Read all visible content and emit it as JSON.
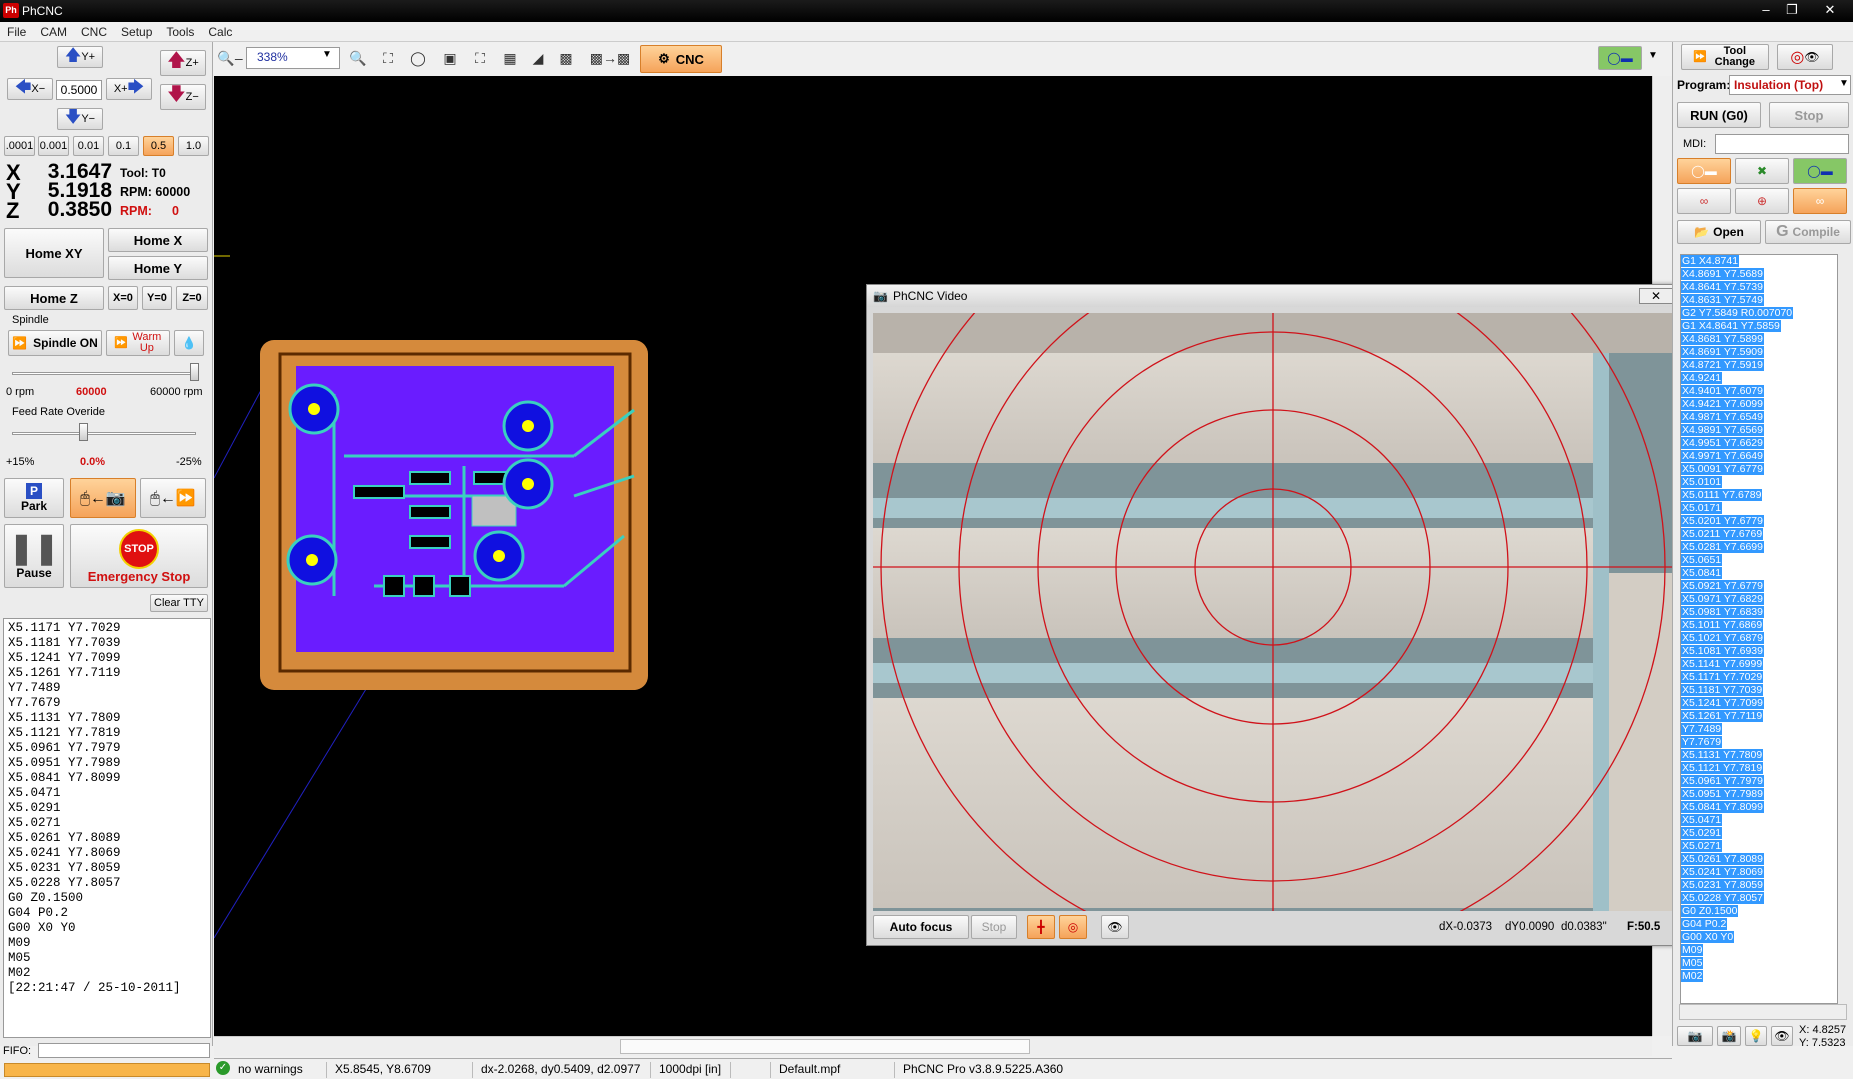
{
  "window": {
    "title": "PhCNC",
    "icon": "phcnc-app-icon"
  },
  "menu": [
    "File",
    "CAM",
    "CNC",
    "Setup",
    "Tools",
    "Calc"
  ],
  "jog": {
    "y_plus": "Y+",
    "y_minus": "Y−",
    "x_minus": "X−",
    "x_plus": "X+",
    "z_plus": "Z+",
    "z_minus": "Z−",
    "step_value": "0.5000",
    "steps": [
      ".0001",
      "0.001",
      "0.01",
      "0.1",
      "0.5",
      "1.0"
    ],
    "selected_step": "0.5"
  },
  "dro": {
    "x_label": "X",
    "x": "3.1647",
    "y_label": "Y",
    "y": "5.1918",
    "z_label": "Z",
    "z": "0.3850",
    "tool": "Tool: T0",
    "rpm_label": "RPM: 60000",
    "rpm_actual_label": "RPM:",
    "rpm_actual": "0"
  },
  "home": {
    "home_xy": "Home XY",
    "home_x": "Home X",
    "home_y": "Home Y",
    "home_z": "Home Z",
    "x0": "X=0",
    "y0": "Y=0",
    "z0": "Z=0"
  },
  "spindle": {
    "section": "Spindle",
    "on": "Spindle ON",
    "warm": "Warm Up",
    "min": "0 rpm",
    "value": "60000",
    "max": "60000 rpm",
    "slider_fraction": 1.0
  },
  "feed": {
    "section": "Feed Rate Overide",
    "left": "+15%",
    "value": "0.0%",
    "right": "-25%",
    "slider_fraction": 0.5
  },
  "actions": {
    "park": "Park",
    "pause": "Pause",
    "stop_sign": "STOP",
    "emergency": "Emergency Stop",
    "clear_tty": "Clear TTY"
  },
  "console_lines": [
    "X5.1171 Y7.7029",
    "X5.1181 Y7.7039",
    "X5.1241 Y7.7099",
    "X5.1261 Y7.7119",
    "Y7.7489",
    "Y7.7679",
    "X5.1131 Y7.7809",
    "X5.1121 Y7.7819",
    "X5.0961 Y7.7979",
    "X5.0951 Y7.7989",
    "X5.0841 Y7.8099",
    "X5.0471",
    "X5.0291",
    "X5.0271",
    "X5.0261 Y7.8089",
    "X5.0241 Y7.8069",
    "X5.0231 Y7.8059",
    "X5.0228 Y7.8057",
    "G0 Z0.1500",
    "G04 P0.2",
    "G00 X0 Y0",
    "M09",
    "M05",
    "M02",
    "[22:21:47 / 25-10-2011]"
  ],
  "fifo_label": "FIFO:",
  "toolbar": {
    "zoom": "338%",
    "cnc": "CNC"
  },
  "right": {
    "tool_change": "Tool Change",
    "program_label": "Program:",
    "program": "Insulation (Top)",
    "run": "RUN (G0)",
    "stop": "Stop",
    "mdi": "MDI:",
    "open": "Open",
    "compile": "Compile",
    "coord_x": "X: 4.8257",
    "coord_y": "Y: 7.5323"
  },
  "gcode_lines": [
    "G1 X4.8741",
    "X4.8691 Y7.5689",
    "X4.8641 Y7.5739",
    "X4.8631 Y7.5749",
    "G2 Y7.5849 R0.007070",
    "G1 X4.8641 Y7.5859",
    "X4.8681 Y7.5899",
    "X4.8691 Y7.5909",
    "X4.8721 Y7.5919",
    "X4.9241",
    "X4.9401 Y7.6079",
    "X4.9421 Y7.6099",
    "X4.9871 Y7.6549",
    "X4.9891 Y7.6569",
    "X4.9951 Y7.6629",
    "X4.9971 Y7.6649",
    "X5.0091 Y7.6779",
    "X5.0101",
    "X5.0111 Y7.6789",
    "X5.0171",
    "X5.0201 Y7.6779",
    "X5.0211 Y7.6769",
    "X5.0281 Y7.6699",
    "X5.0651",
    "X5.0841",
    "X5.0921 Y7.6779",
    "X5.0971 Y7.6829",
    "X5.0981 Y7.6839",
    "X5.1011 Y7.6869",
    "X5.1021 Y7.6879",
    "X5.1081 Y7.6939",
    "X5.1141 Y7.6999",
    "X5.1171 Y7.7029",
    "X5.1181 Y7.7039",
    "X5.1241 Y7.7099",
    "X5.1261 Y7.7119",
    "Y7.7489",
    "Y7.7679",
    "X5.1131 Y7.7809",
    "X5.1121 Y7.7819",
    "X5.0961 Y7.7979",
    "X5.0951 Y7.7989",
    "X5.0841 Y7.8099",
    "X5.0471",
    "X5.0291",
    "X5.0271",
    "X5.0261 Y7.8089",
    "X5.0241 Y7.8069",
    "X5.0231 Y7.8059",
    "X5.0228 Y7.8057",
    "G0 Z0.1500",
    "G04 P0.2",
    "G00 X0 Y0",
    "M09",
    "M05",
    "M02"
  ],
  "video": {
    "title": "PhCNC Video",
    "autofocus": "Auto focus",
    "stop": "Stop",
    "dx": "dX-0.0373",
    "dy": "dY0.0090",
    "d": "d0.0383\"",
    "f": "F:50.5"
  },
  "status": {
    "warnings": "no warnings",
    "pos": "X5.8545, Y8.6709",
    "delta": "dx-2.0268, dy0.5409, d2.0977",
    "dpi": "1000dpi [in]",
    "file": "Default.mpf",
    "version": "PhCNC Pro v3.8.9.5225.A360"
  },
  "colors": {
    "accent": "#f5a35a",
    "board": "#d58a3c",
    "pcb_fill": "#6a1cff",
    "pad": "#1010e0",
    "pad_center": "#ffff00",
    "cross": "#cc0000"
  }
}
